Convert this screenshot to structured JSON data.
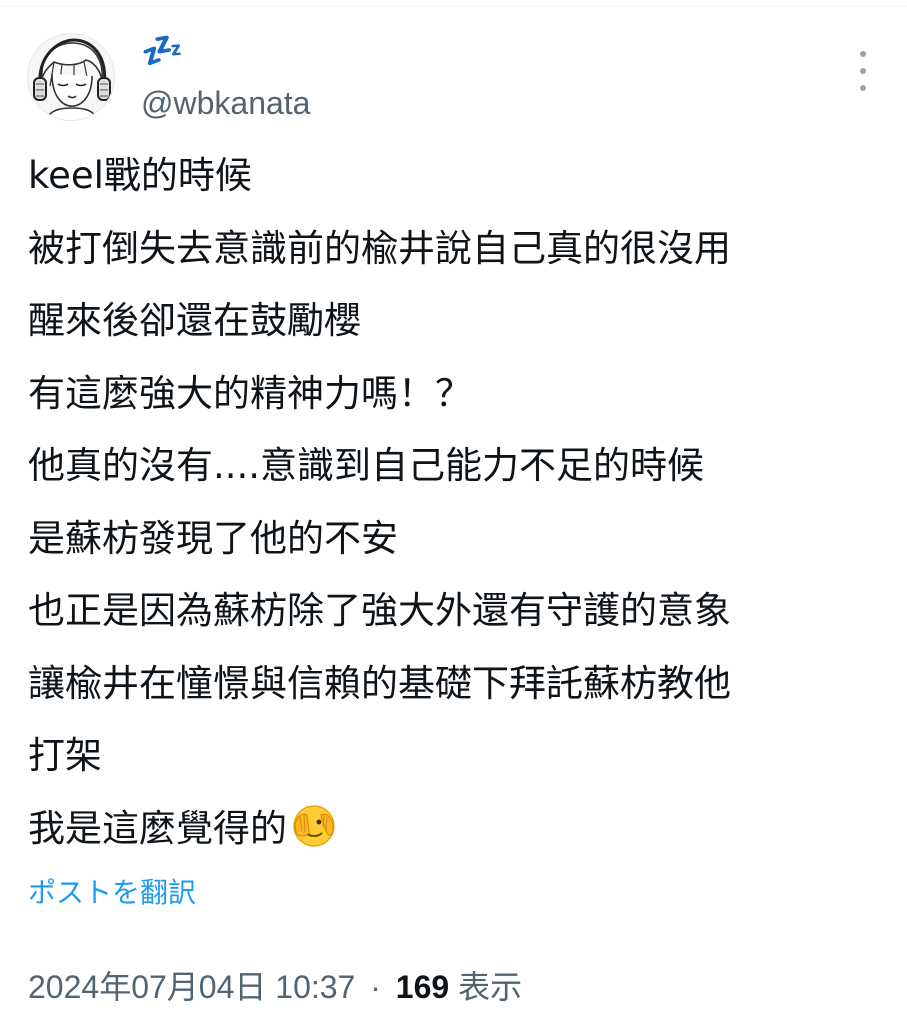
{
  "author": {
    "display_name": "💤",
    "handle": "@wbkanata",
    "avatar_icon": "anime-character-headphones-avatar"
  },
  "more_icon": "more-vertical-icon",
  "tweet": {
    "lines": [
      "keel戰的時候",
      "被打倒失去意識前的楡井說自己真的很沒用",
      "醒來後卻還在鼓勵櫻",
      "有這麼強大的精神力嗎！？",
      "他真的沒有....意識到自己能力不足的時候",
      "是蘇枋發現了他的不安",
      "也正是因為蘇枋除了強大外還有守護的意象",
      "讓楡井在憧憬與信賴的基礎下拜託蘇枋教他",
      "打架",
      "我是這麼覺得的"
    ],
    "trailing_emoji": "face-with-peeking-eye-emoji"
  },
  "translate_label": "ポストを翻訳",
  "meta": {
    "timestamp": "2024年07月04日 10:37",
    "separator": "·",
    "views_count": "169",
    "views_label": "表示"
  },
  "colors": {
    "text": "#0f1419",
    "secondary": "#536471",
    "link": "#1d9bf0"
  }
}
